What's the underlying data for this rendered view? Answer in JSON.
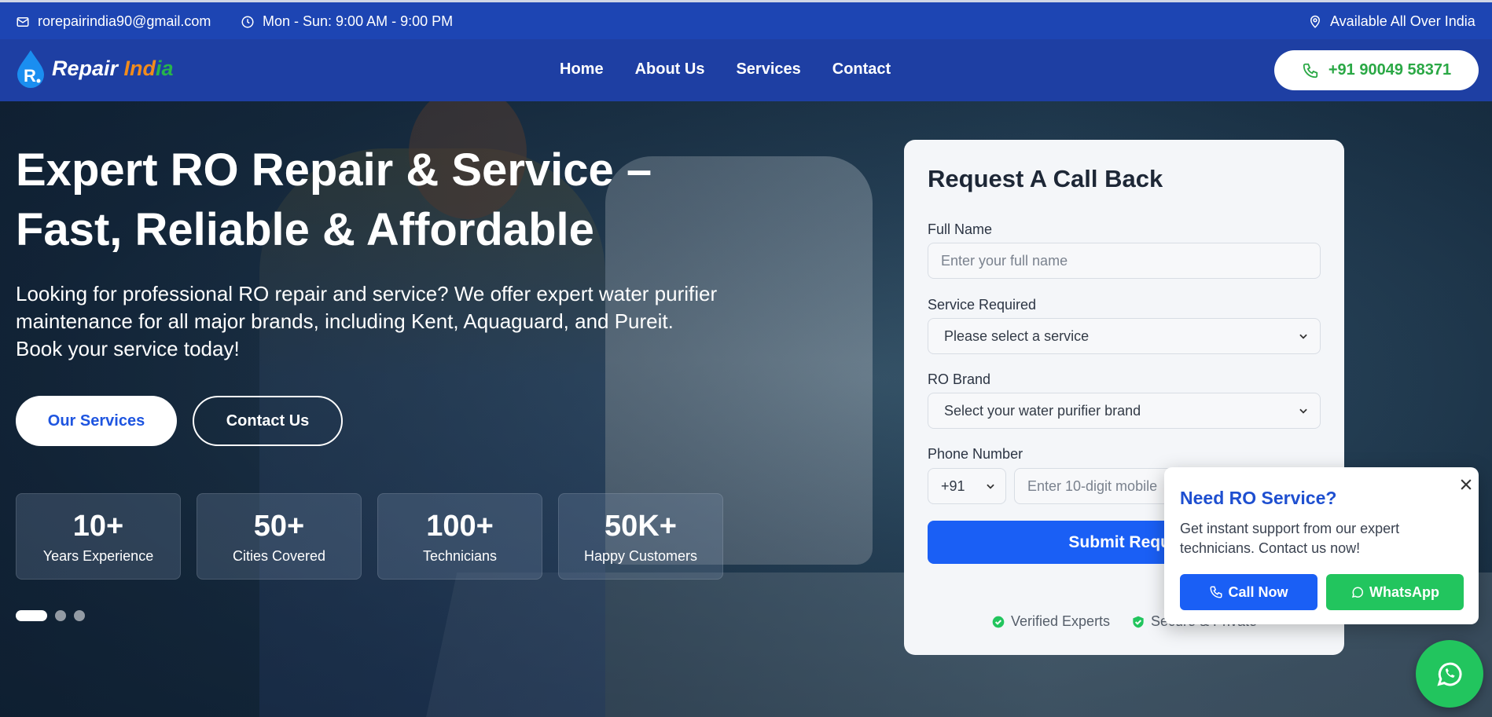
{
  "topbar": {
    "email": "rorepairindia90@gmail.com",
    "hours": "Mon - Sun: 9:00 AM - 9:00 PM",
    "coverage": "Available All Over India"
  },
  "logo": {
    "part1": "Repair ",
    "part2": "Ind",
    "part3": "ia"
  },
  "nav": {
    "home": "Home",
    "about": "About Us",
    "services": "Services",
    "contact": "Contact",
    "phone": "+91 90049 58371"
  },
  "hero": {
    "title": "Expert RO Repair & Service – Fast, Reliable & Affordable",
    "lead": "Looking for professional RO repair and service? We offer expert water purifier maintenance for all major brands, including Kent, Aquaguard, and Pureit. Book your service today!",
    "btn_services": "Our Services",
    "btn_contact": "Contact Us",
    "stats": [
      {
        "num": "10+",
        "label": "Years Experience"
      },
      {
        "num": "50+",
        "label": "Cities Covered"
      },
      {
        "num": "100+",
        "label": "Technicians"
      },
      {
        "num": "50K+",
        "label": "Happy Customers"
      }
    ]
  },
  "form": {
    "title": "Request A Call Back",
    "name_label": "Full Name",
    "name_placeholder": "Enter your full name",
    "service_label": "Service Required",
    "service_value": "Please select a service",
    "brand_label": "RO Brand",
    "brand_value": "Select your water purifier brand",
    "phone_label": "Phone Number",
    "country_code": "+91",
    "phone_placeholder": "Enter 10-digit mobile",
    "submit": "Submit Reque",
    "trust1": "Verified Experts",
    "trust2": "Secure & Private"
  },
  "popup": {
    "title": "Need RO Service?",
    "desc": "Get instant support from our expert technicians. Contact us now!",
    "call": "Call Now",
    "whatsapp": "WhatsApp"
  },
  "colors": {
    "brand_blue": "#1d45b3",
    "accent_blue": "#1a5ff5",
    "green": "#22c55e"
  }
}
